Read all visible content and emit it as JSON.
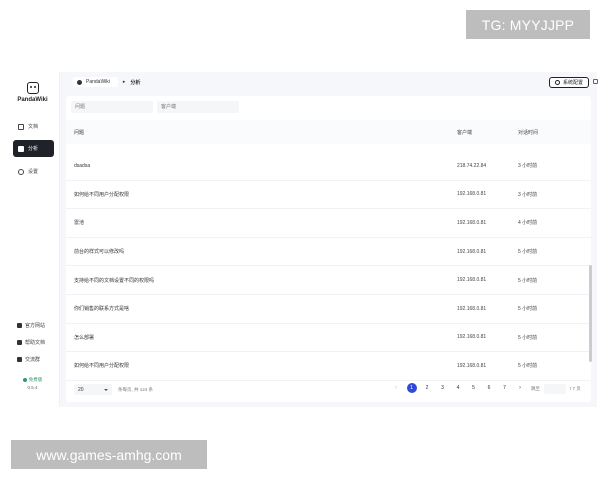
{
  "watermarks": {
    "top": "TG: MYYJJPP",
    "bottom": "www.games-amhg.com"
  },
  "sidebar": {
    "app_name": "PandaWiki",
    "items": [
      {
        "label": "文档",
        "icon": "document-icon"
      },
      {
        "label": "分析",
        "icon": "chart-icon",
        "active": true
      },
      {
        "label": "设置",
        "icon": "gear-icon"
      }
    ],
    "links": [
      {
        "label": "官方网站",
        "icon": "globe-icon"
      },
      {
        "label": "帮助文档",
        "icon": "help-icon"
      },
      {
        "label": "交流群",
        "icon": "group-icon"
      }
    ],
    "edition": "免费版",
    "version": "0.5.4"
  },
  "topbar": {
    "breadcrumb_home": "PandaWiki",
    "breadcrumb_sep": "▸",
    "breadcrumb_current": "分析",
    "settings_button": "系统配置"
  },
  "filters": {
    "question_placeholder": "问题",
    "client_placeholder": "客户端"
  },
  "table": {
    "columns": [
      "问题",
      "客户端",
      "对话时间"
    ],
    "rows": [
      [
        "dsadsa",
        "218.74.22.84",
        "3 小时前"
      ],
      [
        "如何给不同用户分配权限",
        "192.168.0.81",
        "3 小时前"
      ],
      [
        "雷池",
        "192.168.0.81",
        "4 小时前"
      ],
      [
        "前台的样式可以修改吗",
        "192.168.0.81",
        "5 小时前"
      ],
      [
        "支持给不同的文档设置不同的权限吗",
        "192.168.0.81",
        "5 小时前"
      ],
      [
        "你们销售的联系方式是啥",
        "192.168.0.81",
        "5 小时前"
      ],
      [
        "怎么部署",
        "192.168.0.81",
        "5 小时前"
      ],
      [
        "如何给不同用户分配权限",
        "192.168.0.81",
        "5 小时前"
      ]
    ]
  },
  "pagination": {
    "page_size": "20",
    "info": "条每页, 共 124 条",
    "pages": [
      "1",
      "2",
      "3",
      "4",
      "5",
      "6",
      "7"
    ],
    "current": "1",
    "goto_label": "跳至",
    "total_pages": "/ 7 页"
  },
  "colors": {
    "accent": "#3248d9",
    "sidebar_active": "#1f2329"
  }
}
